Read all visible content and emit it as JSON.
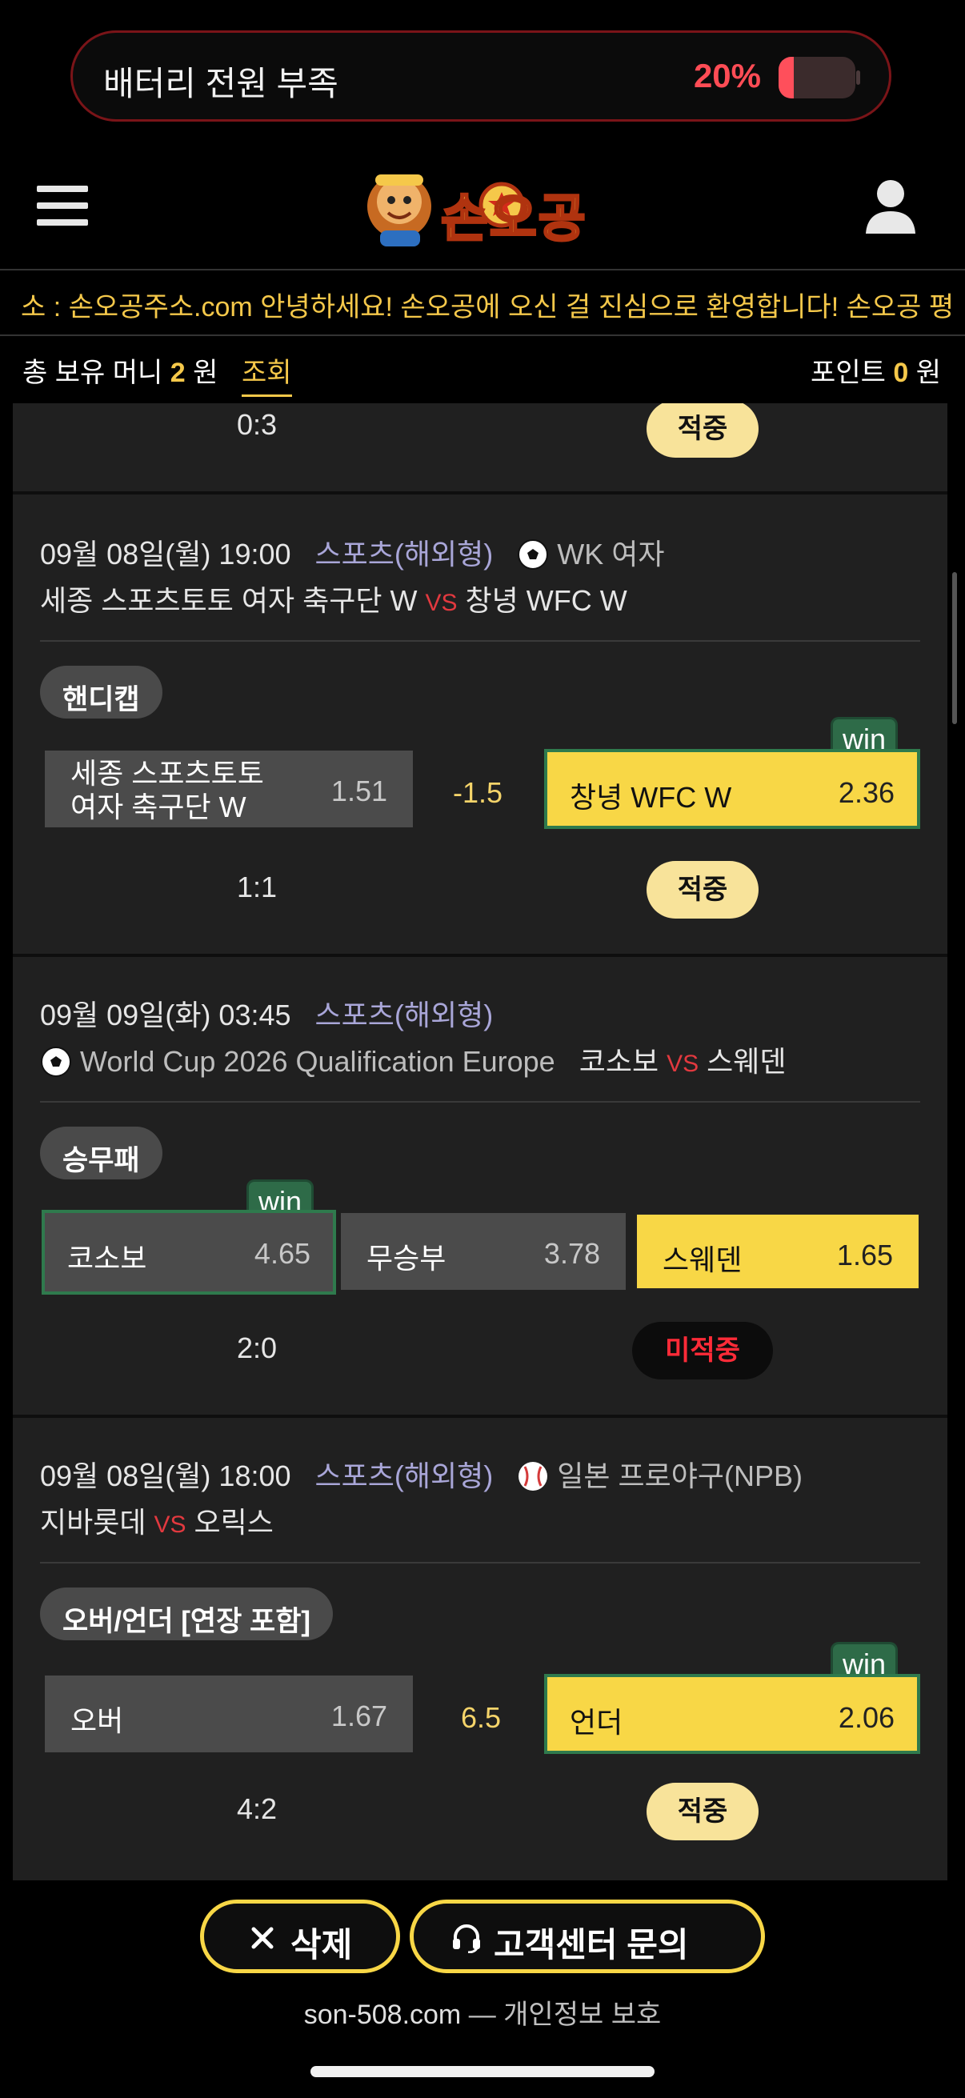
{
  "battery": {
    "text": "배터리 전원 부족",
    "percent_text": "20%",
    "level": 0.2
  },
  "header": {
    "logo_text": "손오공",
    "ticker": "소 : 손오공주소.com   안녕하세요! 손오공에 오신 걸 진심으로 환영합니다! 손오공 평"
  },
  "account": {
    "money_label": "총 보유 머니",
    "money_value": "2",
    "money_unit": "원",
    "inquiry_label": "조회",
    "points_label": "포인트",
    "points_value": "0",
    "points_unit": "원"
  },
  "bets": [
    {
      "score": "0:3",
      "result": "적중"
    },
    {
      "datetime": "09월 08일(월) 19:00",
      "category": "스포츠(해외형)",
      "league": "WK 여자",
      "home": "세종 스포츠토토 여자 축구단 W",
      "vs": "VS",
      "away": "창녕 WFC W",
      "market": "핸디캡",
      "opt1_name_line1": "세종 스포츠토토",
      "opt1_name_line2": "여자 축구단 W",
      "opt1_odds": "1.51",
      "line": "-1.5",
      "opt2_name": "창녕 WFC W",
      "opt2_odds": "2.36",
      "win_badge": "win",
      "score": "1:1",
      "result": "적중"
    },
    {
      "datetime": "09월 09일(화) 03:45",
      "category": "스포츠(해외형)",
      "league": "World Cup 2026 Qualification Europe",
      "home": "코소보",
      "vs": "VS",
      "away": "스웨덴",
      "market": "승무패",
      "opt1_name": "코소보",
      "opt1_odds": "4.65",
      "opt2_name": "무승부",
      "opt2_odds": "3.78",
      "opt3_name": "스웨덴",
      "opt3_odds": "1.65",
      "win_badge": "win",
      "score": "2:0",
      "result": "미적중"
    },
    {
      "datetime": "09월 08일(월) 18:00",
      "category": "스포츠(해외형)",
      "league": "일본 프로야구(NPB)",
      "home": "지바롯데",
      "vs": "VS",
      "away": "오릭스",
      "market": "오버/언더 [연장 포함]",
      "opt1_name": "오버",
      "opt1_odds": "1.67",
      "line": "6.5",
      "opt2_name": "언더",
      "opt2_odds": "2.06",
      "win_badge": "win",
      "score": "4:2",
      "result": "적중"
    }
  ],
  "actions": {
    "delete_label": "삭제",
    "support_label": "고객센터 문의"
  },
  "footer": {
    "domain": "son-508.com",
    "separator": "—",
    "privacy": "개인정보 보호"
  },
  "colors": {
    "accent": "#f8d746",
    "win": "#2e6b48",
    "miss": "#ff2b38",
    "vs": "#e2393f"
  },
  "icons": [
    "menu-icon",
    "user-icon",
    "soccer-ball-icon",
    "baseball-icon",
    "close-icon",
    "headset-icon"
  ]
}
